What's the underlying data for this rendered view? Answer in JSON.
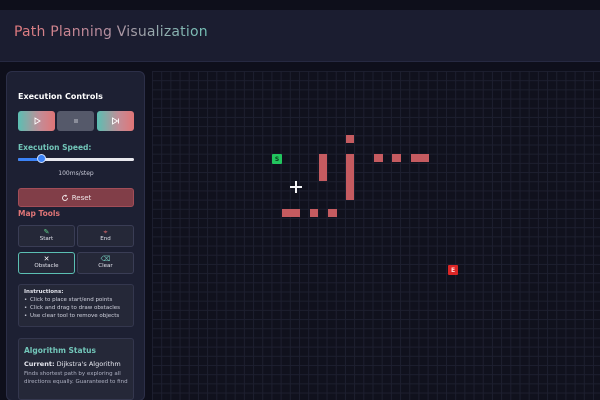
{
  "app": {
    "title": "Path Planning Visualization"
  },
  "execution": {
    "title": "Execution Controls",
    "play_icon": "play-icon",
    "stop_icon": "stop-icon",
    "step_icon": "step-icon",
    "speed_title": "Execution Speed:",
    "speed_label": "100ms/step",
    "speed_fraction": 0.2,
    "reset_label": "Reset",
    "reset_icon": "rotate-icon"
  },
  "map_tools": {
    "title": "Map Tools",
    "tools": [
      {
        "label": "Start",
        "icon": "✎"
      },
      {
        "label": "End",
        "icon": "⌖"
      },
      {
        "label": "Obstacle",
        "icon": "✕"
      },
      {
        "label": "Clear",
        "icon": "⌫"
      }
    ]
  },
  "instructions": {
    "title": "Instructions:",
    "items": [
      "Click to place start/end points",
      "Click and drag to draw obstacles",
      "Use clear tool to remove objects"
    ]
  },
  "algorithm": {
    "title": "Algorithm Status",
    "current_label": "Current:",
    "current_value": "Dijkstra's Algorithm",
    "description": "Finds shortest path by exploring all directions equally. Guaranteed to find"
  },
  "grid": {
    "start_marker": "S",
    "end_marker": "E"
  },
  "colors": {
    "accent_teal": "#72c6b9",
    "accent_red": "#e07577",
    "obstacle": "#c55b60",
    "start": "#22c55e",
    "end": "#dc2626",
    "slider": "#3b82f6"
  }
}
